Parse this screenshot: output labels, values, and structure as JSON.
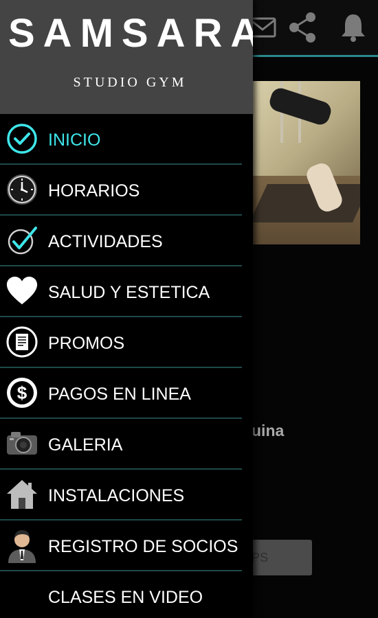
{
  "brand": {
    "name": "SAMSARA",
    "subtitle": "STUDIO GYM"
  },
  "menu": {
    "items": [
      {
        "label": "INICIO",
        "icon": "check-circle-icon",
        "active": true
      },
      {
        "label": "HORARIOS",
        "icon": "clock-icon",
        "active": false
      },
      {
        "label": "ACTIVIDADES",
        "icon": "checkmark-icon",
        "active": false
      },
      {
        "label": "SALUD Y ESTETICA",
        "icon": "heart-icon",
        "active": false
      },
      {
        "label": "PROMOS",
        "icon": "document-icon",
        "active": false
      },
      {
        "label": "PAGOS EN LINEA",
        "icon": "dollar-icon",
        "active": false
      },
      {
        "label": "GALERIA",
        "icon": "camera-icon",
        "active": false
      },
      {
        "label": "INSTALACIONES",
        "icon": "home-icon",
        "active": false
      },
      {
        "label": "REGISTRO DE SOCIOS",
        "icon": "person-icon",
        "active": false
      },
      {
        "label": "CLASES EN VIDEO",
        "icon": "video-icon",
        "active": false
      }
    ]
  },
  "background": {
    "text_fragment": "uina",
    "button_fragment": "PS",
    "toolbar_icons": [
      "mail-icon",
      "share-icon",
      "bell-icon"
    ]
  },
  "colors": {
    "accent": "#3ee6e9",
    "header_bg": "#444444",
    "divider": "#1f4a4a",
    "toolbar_accent": "#2a8a8c"
  }
}
